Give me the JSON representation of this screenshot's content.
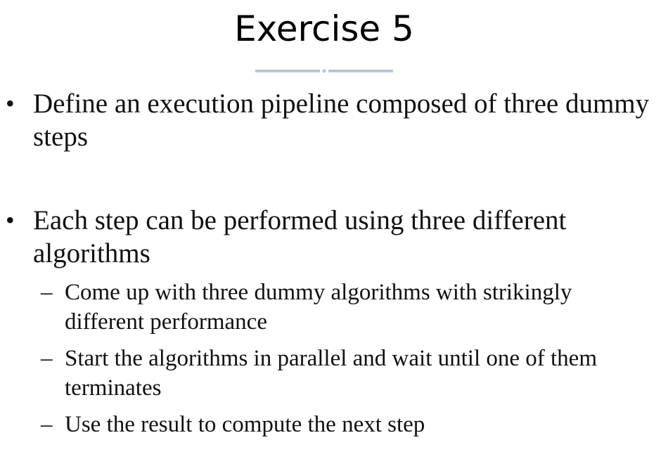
{
  "slide": {
    "title": "Exercise 5",
    "bullets": [
      {
        "text": "Define an execution pipeline composed of three dummy steps"
      },
      {
        "text": "Each step can be performed using three different algorithms",
        "subitems": [
          "Come up with three dummy algorithms with strikingly different performance",
          "Start the algorithms in parallel and wait until one of them terminates",
          "Use the result to compute the next step"
        ]
      }
    ],
    "bullet_symbol": "•",
    "sub_bullet_symbol": "–",
    "divider_color": "#b7c6d6"
  }
}
